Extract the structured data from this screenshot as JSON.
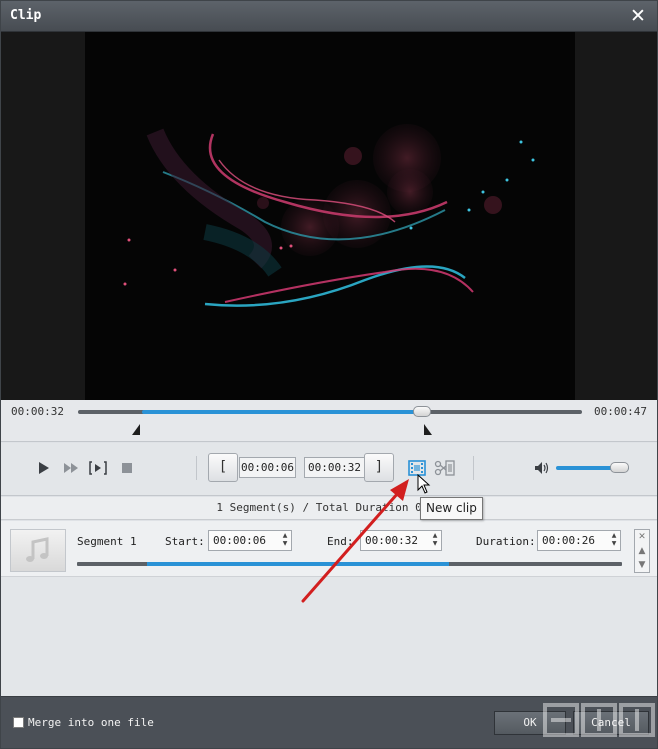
{
  "window": {
    "title": "Clip",
    "close_icon": "close-icon"
  },
  "timeline": {
    "current_time": "00:00:32",
    "total_time": "00:00:47",
    "position_fraction": 0.69,
    "start_fraction": 0.13,
    "end_fraction": 0.69
  },
  "controls": {
    "play_icon": "play-icon",
    "fast_forward_icon": "fast-forward-icon",
    "step_icon": "step-play-icon",
    "stop_icon": "stop-icon",
    "set_start_label": "[",
    "start_time": "00:00:06",
    "end_time": "00:00:32",
    "set_end_label": "]",
    "new_clip_icon": "film-icon",
    "cut_icon": "scissors-film-icon",
    "volume_icon": "speaker-icon",
    "volume_fraction": 0.85
  },
  "summary": {
    "text": "1 Segment(s) / Total Duration 00:0"
  },
  "tooltip": {
    "text": "New clip"
  },
  "segments": [
    {
      "thumbnail_icon": "music-note-icon",
      "name": "Segment 1",
      "start_label": "Start:",
      "start": "00:00:06",
      "end_label": "End:",
      "end": "00:00:32",
      "duration_label": "Duration:",
      "duration": "00:00:26"
    }
  ],
  "footer": {
    "merge_label": "Merge into one file",
    "merge_checked": false,
    "ok_label": "OK",
    "cancel_label": "Cancel"
  },
  "colors": {
    "accent": "#2a92d6",
    "titlebar": "#4e5359",
    "footer": "#4b5057",
    "arrow": "#d21f1f"
  }
}
